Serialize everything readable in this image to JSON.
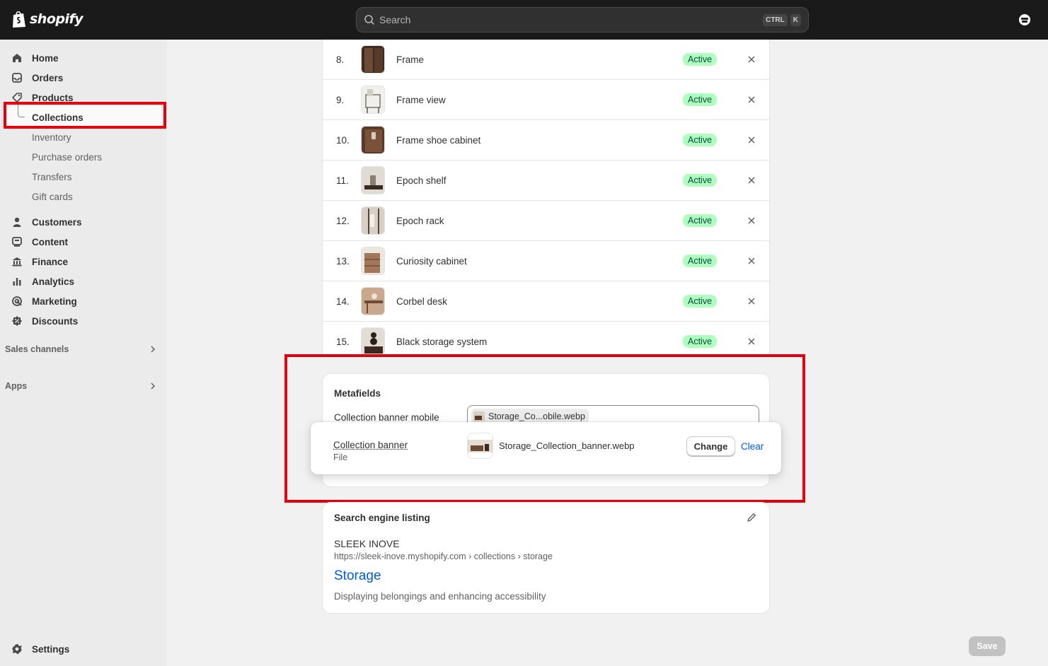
{
  "topbar": {
    "logo_text": "shopify",
    "search_placeholder": "Search",
    "shortcut_keys": [
      "CTRL",
      "K"
    ]
  },
  "sidebar": {
    "items": [
      {
        "label": "Home",
        "icon": "home-icon"
      },
      {
        "label": "Orders",
        "icon": "inbox-icon"
      },
      {
        "label": "Products",
        "icon": "tag-icon"
      }
    ],
    "product_subitems": [
      "Collections",
      "Inventory",
      "Purchase orders",
      "Transfers",
      "Gift cards"
    ],
    "items2": [
      {
        "label": "Customers",
        "icon": "person-icon"
      },
      {
        "label": "Content",
        "icon": "content-icon"
      },
      {
        "label": "Finance",
        "icon": "bank-icon"
      },
      {
        "label": "Analytics",
        "icon": "bar-chart-icon"
      },
      {
        "label": "Marketing",
        "icon": "target-icon"
      },
      {
        "label": "Discounts",
        "icon": "discount-icon"
      }
    ],
    "sales_channels": "Sales channels",
    "apps": "Apps",
    "settings": "Settings"
  },
  "products": [
    {
      "num": "8.",
      "name": "Frame",
      "status": "Active",
      "thumb": "#6b4a36"
    },
    {
      "num": "9.",
      "name": "Frame view",
      "status": "Active",
      "thumb": "#d9d6d1"
    },
    {
      "num": "10.",
      "name": "Frame shoe cabinet",
      "status": "Active",
      "thumb": "#5a3a28"
    },
    {
      "num": "11.",
      "name": "Epoch shelf",
      "status": "Active",
      "thumb": "#cbc5bd"
    },
    {
      "num": "12.",
      "name": "Epoch rack",
      "status": "Active",
      "thumb": "#c9beaf"
    },
    {
      "num": "13.",
      "name": "Curiosity cabinet",
      "status": "Active",
      "thumb": "#a2785a"
    },
    {
      "num": "14.",
      "name": "Corbel desk",
      "status": "Active",
      "thumb": "#b89478"
    },
    {
      "num": "15.",
      "name": "Black storage system",
      "status": "Active",
      "thumb": "#3a2a22"
    }
  ],
  "metafields": {
    "title": "Metafields",
    "mobile_label": "Collection banner mobile",
    "mobile_file": "Storage_Co...obile.webp",
    "banner_label": "Collection banner",
    "banner_type": "File",
    "banner_file": "Storage_Collection_banner.webp",
    "change_label": "Change",
    "clear_label": "Clear"
  },
  "seo": {
    "title": "Search engine listing",
    "store": "SLEEK INOVE",
    "url": "https://sleek-inove.myshopify.com › collections › storage",
    "page_title": "Storage",
    "description": "Displaying belongings and enhancing accessibility"
  },
  "save_label": "Save",
  "colors": {
    "active_badge_bg": "#affebf",
    "link": "#005bd3",
    "annotation_red": "#e0000f"
  }
}
